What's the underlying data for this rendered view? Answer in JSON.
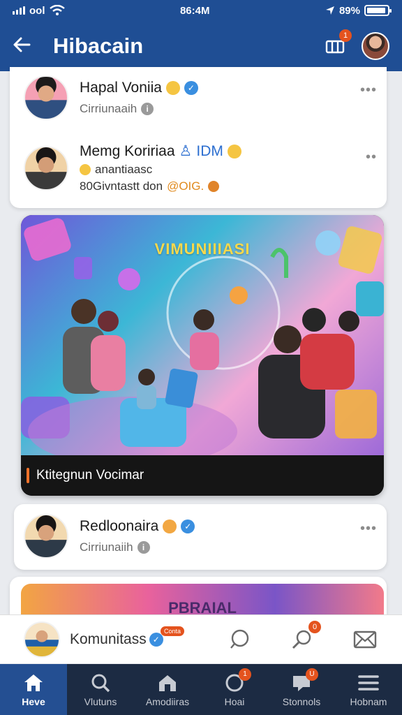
{
  "status_bar": {
    "carrier": "ool",
    "time": "86:4M",
    "battery": "89%"
  },
  "app_bar": {
    "title": "Hibacain",
    "notification_count": "1"
  },
  "feed": {
    "posts": [
      {
        "name": "Hapal Voniia",
        "subtitle": "Cirriunaaih"
      },
      {
        "name": "Memg Koririaa",
        "tag": "IDM",
        "line2": "anantiaasc",
        "line3": "80Givntastt don",
        "line3_tag": "@OIG."
      }
    ],
    "featured": {
      "image_text": "VIMUNIIIASI",
      "caption": "Ktitegnun Vocimar"
    },
    "post3": {
      "name": "Redloonaira",
      "subtitle": "Cirriunaiih"
    },
    "banner2": {
      "image_text": "PBRAIAL"
    }
  },
  "composer": {
    "label": "Komunitass",
    "pill": "Conta",
    "badge": "0"
  },
  "bottom_nav": {
    "items": [
      {
        "label": "Heve",
        "icon": "home-icon",
        "badge": ""
      },
      {
        "label": "Vlutuns",
        "icon": "search-icon",
        "badge": ""
      },
      {
        "label": "Amodiiras",
        "icon": "house-icon",
        "badge": ""
      },
      {
        "label": "Hoai",
        "icon": "bell-icon",
        "badge": "1"
      },
      {
        "label": "Stonnols",
        "icon": "chat-icon",
        "badge": "U"
      },
      {
        "label": "Hobnam",
        "icon": "menu-icon",
        "badge": ""
      }
    ]
  },
  "colors": {
    "app_bar": "#1f4e94",
    "bottom_nav": "#1c2b43",
    "active_nav": "#244f92",
    "badge": "#e4531e",
    "verified": "#3a8fe0"
  }
}
